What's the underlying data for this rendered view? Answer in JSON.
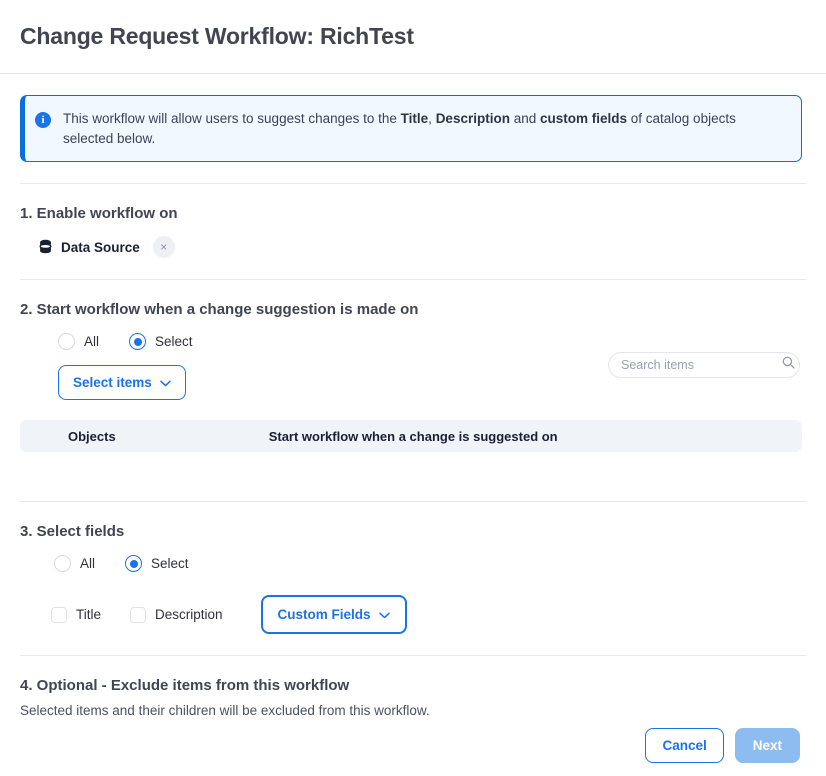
{
  "header": {
    "title": "Change Request Workflow: RichTest"
  },
  "banner": {
    "icon": "info-icon",
    "icon_glyph": "i",
    "text_part1": "This workflow will allow users to suggest changes to the ",
    "bold1": "Title",
    "text_part2": ", ",
    "bold2": "Description",
    "text_part3": " and ",
    "bold3": "custom fields",
    "text_part4": " of catalog objects selected below."
  },
  "section1": {
    "title": "1. Enable workflow on",
    "chip": {
      "icon": "database-icon",
      "label": "Data Source",
      "close_glyph": "×"
    }
  },
  "section2": {
    "title": "2. Start workflow when a change suggestion is made on",
    "radios": [
      {
        "label": "All",
        "selected": false
      },
      {
        "label": "Select",
        "selected": true
      }
    ],
    "select_items_button": "Select items",
    "search": {
      "placeholder": "Search items",
      "value": "",
      "icon": "search-icon"
    },
    "table": {
      "columns": [
        "Objects",
        "Start workflow when a change is suggested on"
      ],
      "rows": []
    }
  },
  "section3": {
    "title": "3. Select fields",
    "radios": [
      {
        "label": "All",
        "selected": false
      },
      {
        "label": "Select",
        "selected": true
      }
    ],
    "checkboxes": [
      {
        "label": "Title",
        "checked": false
      },
      {
        "label": "Description",
        "checked": false
      }
    ],
    "custom_fields_button": "Custom Fields"
  },
  "section4": {
    "title": "4. Optional - Exclude items from this workflow",
    "subtitle": "Selected items and their children will be excluded from this workflow."
  },
  "footer": {
    "cancel_label": "Cancel",
    "next_label": "Next"
  },
  "colors": {
    "accent": "#1a73e8",
    "banner_bg": "#f2f8ff",
    "banner_border": "#0b6fdb",
    "table_head_bg": "#f0f3f7",
    "next_disabled": "#8cbcf0",
    "title": "#414552"
  }
}
